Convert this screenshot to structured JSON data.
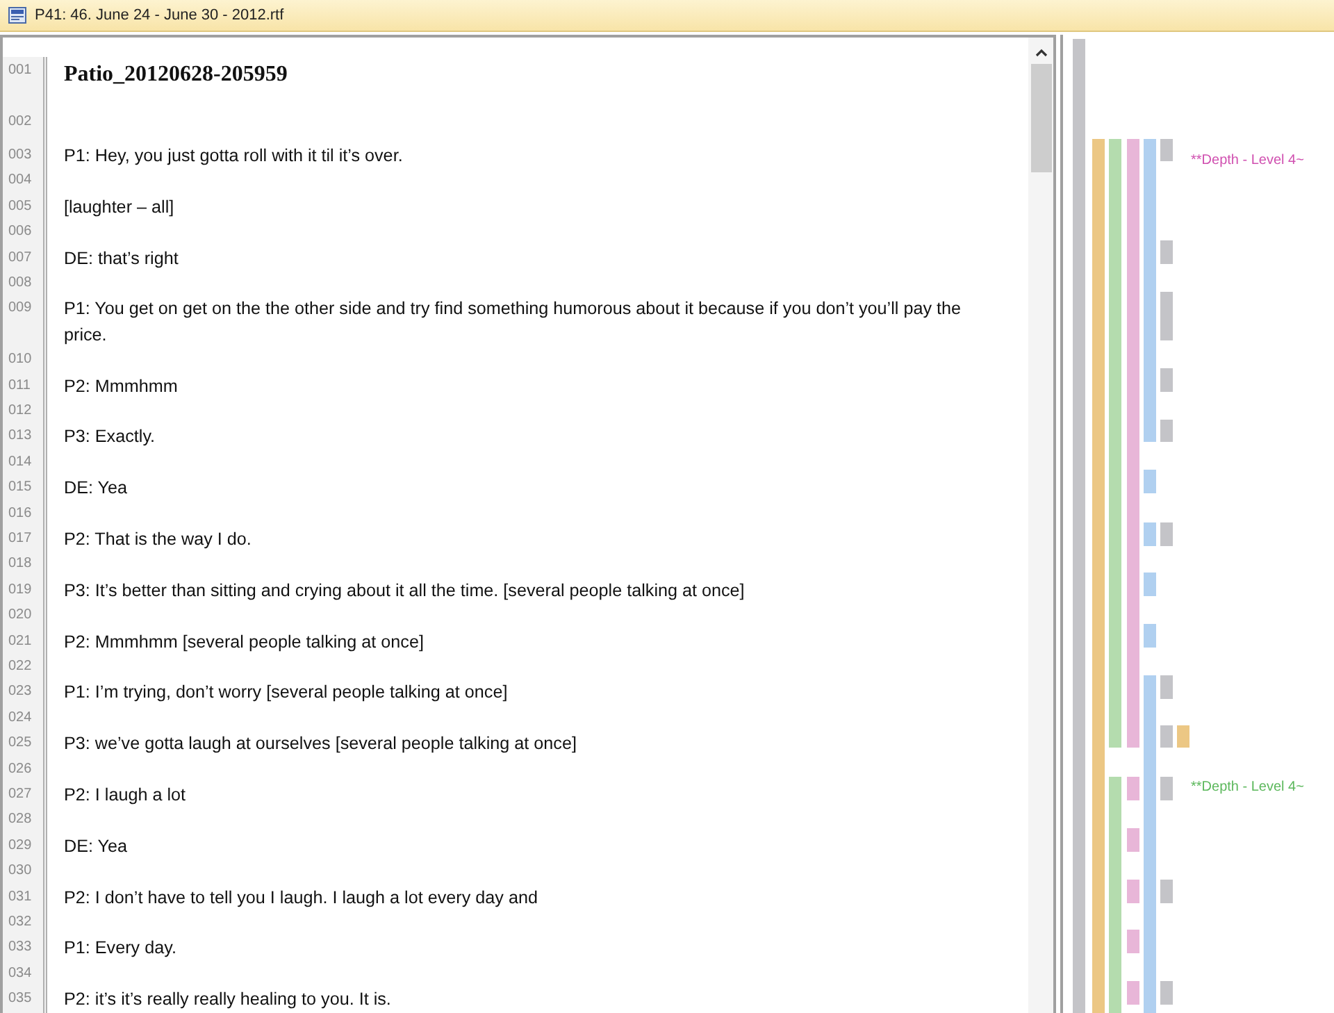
{
  "window": {
    "title": "P41: 46. June 24 - June 30 - 2012.rtf"
  },
  "document": {
    "rows": [
      {
        "number": "001",
        "kind": "title",
        "text": "Patio_20120628-205959"
      },
      {
        "number": "002",
        "kind": "blank"
      },
      {
        "number": "003",
        "kind": "text",
        "text": "P1: Hey, you just gotta roll with it til it’s over."
      },
      {
        "number": "004",
        "kind": "blank"
      },
      {
        "number": "005",
        "kind": "text",
        "text": "[laughter – all]"
      },
      {
        "number": "006",
        "kind": "blank"
      },
      {
        "number": "007",
        "kind": "text",
        "text": "DE: that’s right"
      },
      {
        "number": "008",
        "kind": "blank"
      },
      {
        "number": "009",
        "kind": "text",
        "text": "P1: You get on get on the the other side and try find something humorous about it because if you don’t you’ll pay the price."
      },
      {
        "number": "010",
        "kind": "blank"
      },
      {
        "number": "011",
        "kind": "text",
        "text": "P2: Mmmhmm"
      },
      {
        "number": "012",
        "kind": "blank"
      },
      {
        "number": "013",
        "kind": "text",
        "text": "P3: Exactly."
      },
      {
        "number": "014",
        "kind": "blank"
      },
      {
        "number": "015",
        "kind": "text",
        "text": "DE: Yea"
      },
      {
        "number": "016",
        "kind": "blank"
      },
      {
        "number": "017",
        "kind": "text",
        "text": "P2: That is the way I do."
      },
      {
        "number": "018",
        "kind": "blank"
      },
      {
        "number": "019",
        "kind": "text",
        "text": "P3: It’s better than sitting and crying about it all the time. [several people talking at once]"
      },
      {
        "number": "020",
        "kind": "blank"
      },
      {
        "number": "021",
        "kind": "text",
        "text": "P2: Mmmhmm [several people talking at once]"
      },
      {
        "number": "022",
        "kind": "blank"
      },
      {
        "number": "023",
        "kind": "text",
        "text": "P1: I’m trying, don’t worry [several people talking at once]"
      },
      {
        "number": "024",
        "kind": "blank"
      },
      {
        "number": "025",
        "kind": "text",
        "text": "P3: we’ve gotta laugh at ourselves [several people talking at once]"
      },
      {
        "number": "026",
        "kind": "blank"
      },
      {
        "number": "027",
        "kind": "text",
        "text": "P2: I laugh a lot"
      },
      {
        "number": "028",
        "kind": "blank"
      },
      {
        "number": "029",
        "kind": "text",
        "text": "DE: Yea"
      },
      {
        "number": "030",
        "kind": "blank"
      },
      {
        "number": "031",
        "kind": "text",
        "text": "P2: I don’t have to tell you I laugh. I laugh a lot every day and"
      },
      {
        "number": "032",
        "kind": "blank"
      },
      {
        "number": "033",
        "kind": "text",
        "text": "P1: Every day."
      },
      {
        "number": "034",
        "kind": "blank"
      },
      {
        "number": "035",
        "kind": "text",
        "text": "P2: it’s it’s really really healing to you. It is."
      }
    ]
  },
  "margin": {
    "codes": [
      {
        "label": "**Depth - Level 4~",
        "color": "#d050b0"
      },
      {
        "label": "**Depth - Level 4~",
        "color": "#5cb85c"
      }
    ]
  }
}
